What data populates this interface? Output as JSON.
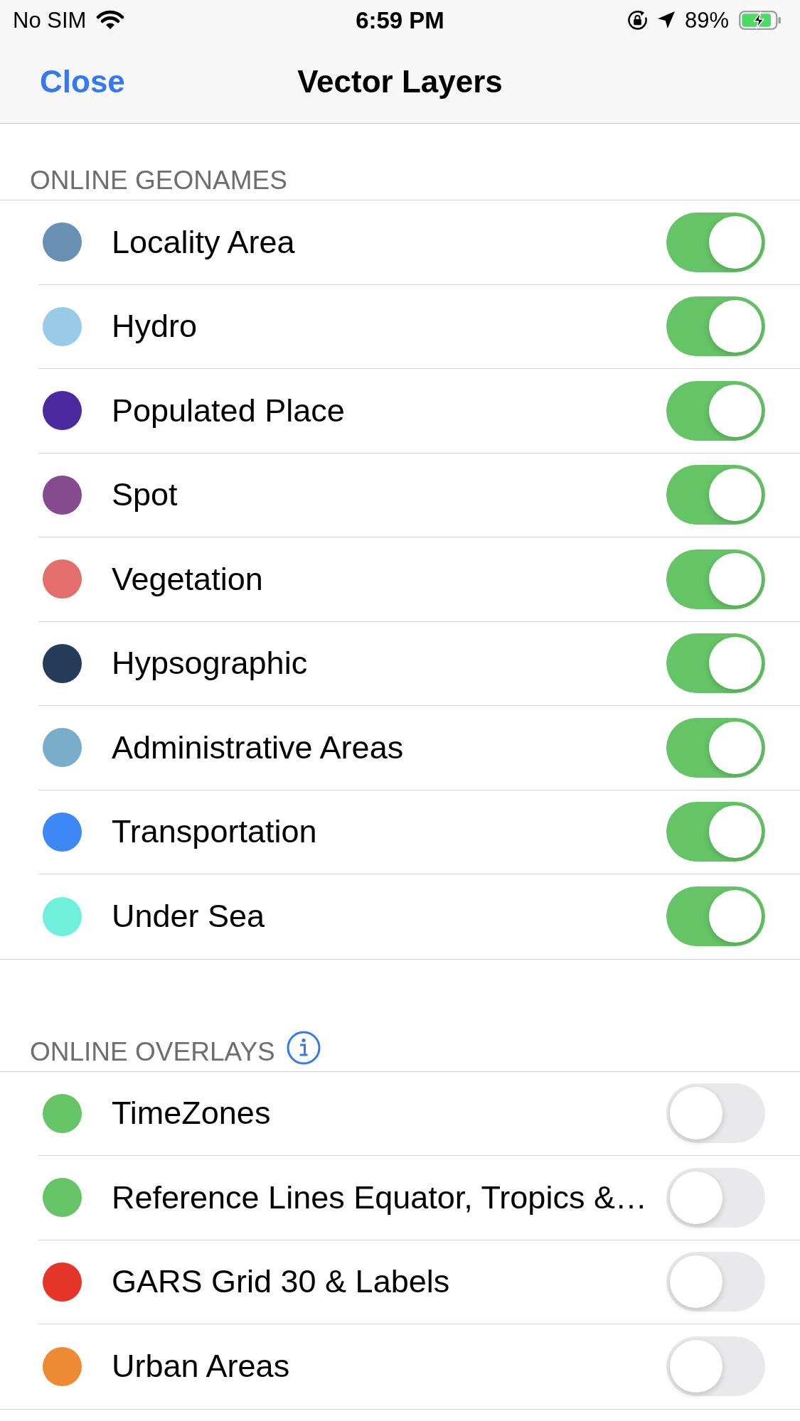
{
  "status_bar": {
    "carrier": "No SIM",
    "time": "6:59 PM",
    "battery": "89%"
  },
  "nav_bar": {
    "left_button": "Close",
    "title": "Vector Layers"
  },
  "sections": [
    {
      "header": "ONLINE GEONAMES",
      "info_button": false,
      "items": [
        {
          "label": "Locality Area",
          "color": "#6890b4",
          "on": true
        },
        {
          "label": "Hydro",
          "color": "#9acbe6",
          "on": true
        },
        {
          "label": "Populated Place",
          "color": "#4b2aa0",
          "on": true
        },
        {
          "label": "Spot",
          "color": "#864a8f",
          "on": true
        },
        {
          "label": "Vegetation",
          "color": "#e36e6b",
          "on": true
        },
        {
          "label": "Hypsographic",
          "color": "#253c5a",
          "on": true
        },
        {
          "label": "Administrative Areas",
          "color": "#78aec9",
          "on": true
        },
        {
          "label": "Transportation",
          "color": "#3e88f5",
          "on": true
        },
        {
          "label": "Under Sea",
          "color": "#70efdc",
          "on": true
        }
      ]
    },
    {
      "header": "ONLINE OVERLAYS",
      "info_button": true,
      "items": [
        {
          "label": "TimeZones",
          "color": "#64c466",
          "on": false
        },
        {
          "label": "Reference Lines Equator, Tropics &…",
          "color": "#64c466",
          "on": false
        },
        {
          "label": "GARS Grid 30 & Labels",
          "color": "#e53528",
          "on": false
        },
        {
          "label": "Urban Areas",
          "color": "#ee8a34",
          "on": false
        }
      ]
    }
  ]
}
